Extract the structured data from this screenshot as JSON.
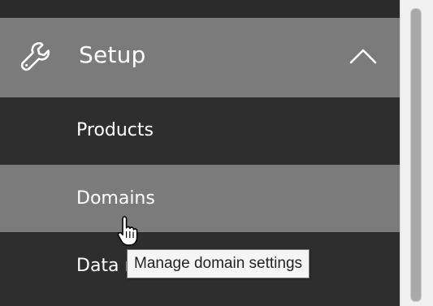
{
  "nav": {
    "section": {
      "label": "Setup",
      "icon": "wrench-icon",
      "expanded_icon": "chevron-up-icon"
    },
    "items": [
      {
        "label": "Products"
      },
      {
        "label": "Domains",
        "state": "hovered"
      },
      {
        "label": "Data r"
      }
    ]
  },
  "tooltip": {
    "text": "Manage domain settings"
  },
  "colors": {
    "nav_background": "#2e2e2e",
    "selected_background": "#7b7b7b",
    "text": "#ffffff"
  }
}
